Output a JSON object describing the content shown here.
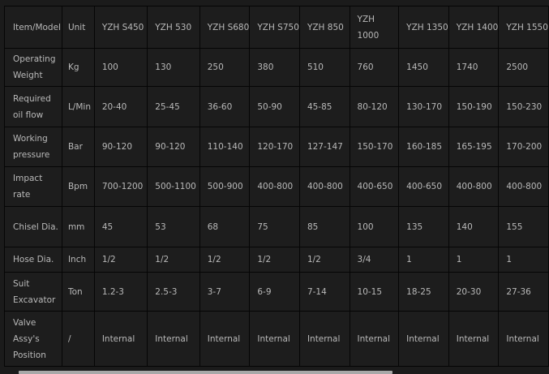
{
  "table": {
    "headers": [
      "Item/Model",
      "Unit",
      "YZH S450",
      "YZH 530",
      "YZH S680",
      "YZH S750",
      "YZH 850",
      "YZH 1000",
      "YZH 1350",
      "YZH 1400",
      "YZH 1550"
    ],
    "rows": [
      [
        "Operating Weight",
        "Kg",
        "100",
        "130",
        "250",
        "380",
        "510",
        "760",
        "1450",
        "1740",
        "2500"
      ],
      [
        "Required oil flow",
        "L/Min",
        "20-40",
        "25-45",
        "36-60",
        "50-90",
        "45-85",
        "80-120",
        "130-170",
        "150-190",
        "150-230"
      ],
      [
        "Working pressure",
        "Bar",
        "90-120",
        "90-120",
        "110-140",
        "120-170",
        "127-147",
        "150-170",
        "160-185",
        "165-195",
        "170-200"
      ],
      [
        "Impact rate",
        "Bpm",
        "700-1200",
        "500-1100",
        "500-900",
        "400-800",
        "400-800",
        "400-650",
        "400-650",
        "400-800",
        "400-800"
      ],
      [
        "Chisel Dia.",
        "mm",
        "45",
        "53",
        "68",
        "75",
        "85",
        "100",
        "135",
        "140",
        "155"
      ],
      [
        "Hose Dia.",
        "Inch",
        "1/2",
        "1/2",
        "1/2",
        "1/2",
        "1/2",
        "3/4",
        "1",
        "1",
        "1"
      ],
      [
        "Suit Excavator",
        "Ton",
        "1.2-3",
        "2.5-3",
        "3-7",
        "6-9",
        "7-14",
        "10-15",
        "18-25",
        "20-30",
        "27-36"
      ],
      [
        "Valve Assy's Position",
        "/",
        "Internal",
        "Internal",
        "Internal",
        "Internal",
        "Internal",
        "Internal",
        "Internal",
        "Internal",
        "Internal"
      ]
    ]
  }
}
